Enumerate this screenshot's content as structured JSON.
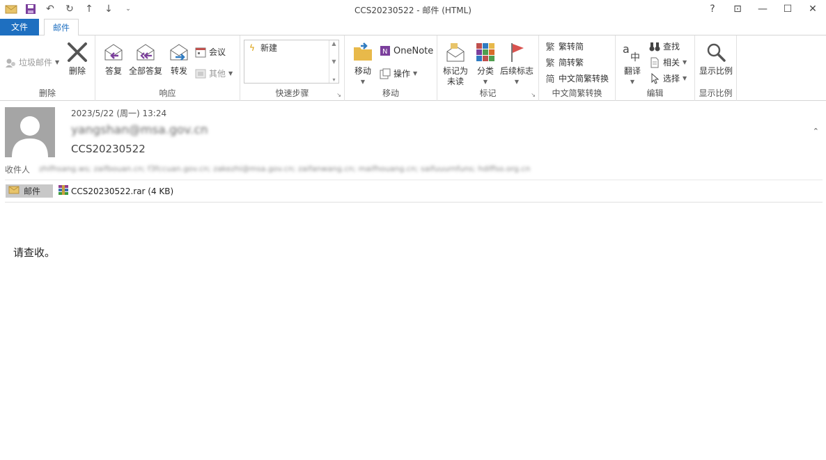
{
  "window": {
    "title": "CCS20230522 - 邮件 (HTML)",
    "controls": {
      "help": "?",
      "restore_ribbon": "⊡",
      "minimize": "—",
      "maximize": "☐",
      "close": "✕"
    }
  },
  "tabs": {
    "file": "文件",
    "mail": "邮件"
  },
  "ribbon": {
    "delete_group": {
      "junk": "垃圾邮件",
      "delete": "删除",
      "label": "删除"
    },
    "respond_group": {
      "reply": "答复",
      "reply_all": "全部答复",
      "forward": "转发",
      "meeting": "会议",
      "more": "其他",
      "label": "响应"
    },
    "quick_steps": {
      "item": "新建",
      "label": "快速步骤"
    },
    "move_group": {
      "move": "移动",
      "onenote": "OneNote",
      "actions": "操作",
      "label": "移动"
    },
    "tags_group": {
      "mark_unread": "标记为\n未读",
      "mark_unread_l1": "标记为",
      "mark_unread_l2": "未读",
      "categorize": "分类",
      "follow_up": "后续标志",
      "label": "标记"
    },
    "chinese_group": {
      "t2s": "繁转简",
      "s2t": "简转繁",
      "convert": "中文简繁转换",
      "label": "中文简繁转换"
    },
    "edit_group": {
      "translate": "翻译",
      "find": "查找",
      "related": "相关",
      "select": "选择",
      "label": "编辑"
    },
    "zoom_group": {
      "zoom": "显示比例",
      "label": "显示比例"
    }
  },
  "message": {
    "datetime": "2023/5/22 (周一) 13:24",
    "sender": "yangshan@msa.gov.cn",
    "subject": "CCS20230522",
    "to_label": "收件人",
    "recipients": "zhifhsang.ws; zaifbouan.cn; f3fccuan.gov.cn; zakezhi@msa.gov.cn; zaifanwang.cn; maifhouang.cn; saifuuurnfuns; hdiffso.org.cn",
    "mail_chip": "邮件",
    "attachment": "CCS20230522.rar (4 KB)",
    "body": "请查收。"
  }
}
